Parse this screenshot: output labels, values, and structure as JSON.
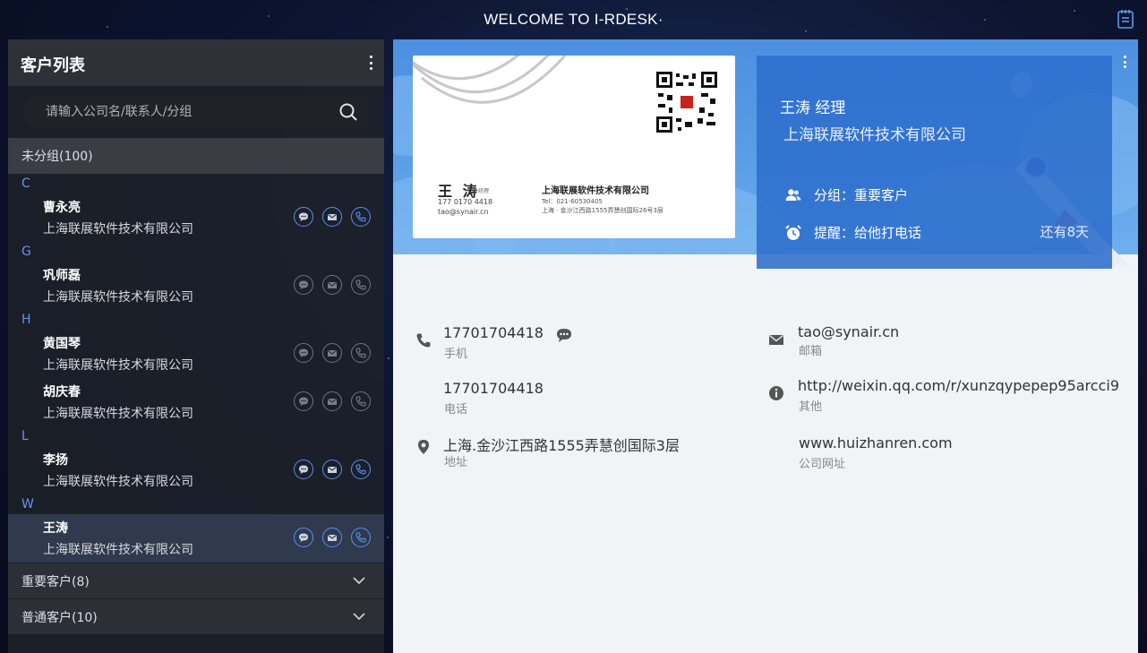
{
  "app": {
    "title": "WELCOME  TO I-RDESK·"
  },
  "sidebar": {
    "title": "客户列表",
    "search_placeholder": "请输入公司名/联系人/分组",
    "ungrouped": {
      "label": "未分组(100)",
      "sections": [
        {
          "letter": "C",
          "contacts": [
            {
              "name": "曹永亮",
              "company": "上海联展软件技术有限公司",
              "phone_active": true
            }
          ]
        },
        {
          "letter": "G",
          "contacts": [
            {
              "name": "巩师磊",
              "company": "上海联展软件技术有限公司",
              "phone_active": false
            }
          ]
        },
        {
          "letter": "H",
          "contacts": [
            {
              "name": "黄国琴",
              "company": "上海联展软件技术有限公司",
              "phone_active": false
            },
            {
              "name": "胡庆春",
              "company": "上海联展软件技术有限公司",
              "phone_active": false
            }
          ]
        },
        {
          "letter": "L",
          "contacts": [
            {
              "name": "李扬",
              "company": "上海联展软件技术有限公司",
              "phone_active": true
            }
          ]
        },
        {
          "letter": "W",
          "contacts": [
            {
              "name": "王涛",
              "company": "上海联展软件技术有限公司",
              "phone_active": true,
              "selected": true
            }
          ]
        }
      ]
    },
    "groups": [
      {
        "label": "重要客户(8)"
      },
      {
        "label": "普通客户(10)"
      }
    ]
  },
  "card": {
    "name": "王 涛",
    "title": "总经理",
    "phone": "177 0170 4418",
    "email": "tao@synair.cn",
    "company": "上海联展软件技术有限公司",
    "tel": "Tel：021-60530405",
    "address": "上海 · 金沙江西路1555弄慧创国际26号3层"
  },
  "detail": {
    "name_title": "王涛  经理",
    "company": "上海联展软件技术有限公司",
    "group": "分组：重要客户",
    "reminder": "提醒：给他打电话",
    "remaining": "还有8天",
    "fields": {
      "mobile": {
        "value": "17701704418",
        "label": "手机"
      },
      "phone": {
        "value": "17701704418",
        "label": "电话"
      },
      "address": {
        "value": "上海.金沙江西路1555弄慧创国际3层",
        "label": "地址"
      },
      "email": {
        "value": "tao@synair.cn",
        "label": "邮箱"
      },
      "other": {
        "value": "http://weixin.qq.com/r/xunzqypepep95arcci9",
        "label": "其他"
      },
      "website": {
        "value": "www.huizhanren.com",
        "label": "公司网址"
      }
    }
  },
  "colors": {
    "accent": "#5a8ff0",
    "panel_blue": "#2d6ecd",
    "letter": "#6b93e8"
  }
}
